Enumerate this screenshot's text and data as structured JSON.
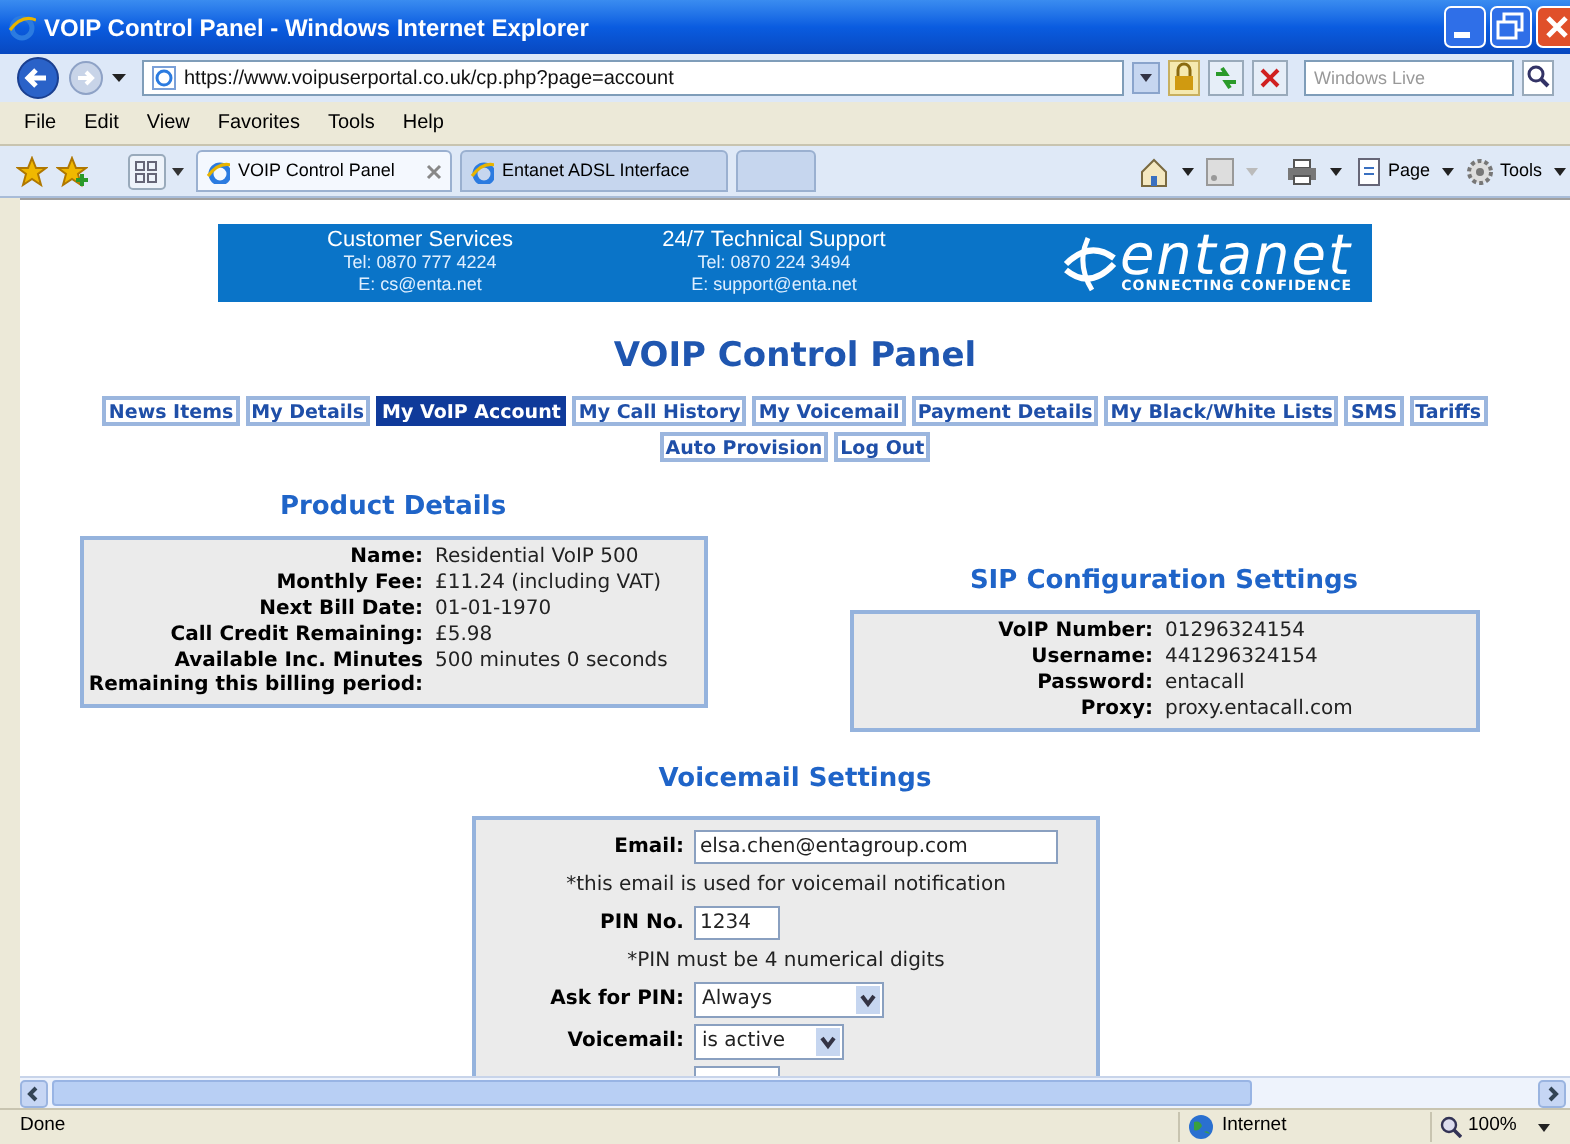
{
  "window": {
    "title": "VOIP Control Panel - Windows Internet Explorer"
  },
  "address_bar": {
    "url": "https://www.voipuserportal.co.uk/cp.php?page=account",
    "search_placeholder": "Windows Live"
  },
  "menu": [
    "File",
    "Edit",
    "View",
    "Favorites",
    "Tools",
    "Help"
  ],
  "tabs": [
    {
      "label": "VOIP Control Panel",
      "selected": true
    },
    {
      "label": "Entanet ADSL Interface",
      "selected": false
    }
  ],
  "command_bar": [
    "Page",
    "Tools"
  ],
  "banner": {
    "customer": {
      "heading": "Customer Services",
      "tel": "Tel: 0870 777 4224",
      "email": "E: cs@enta.net"
    },
    "support": {
      "heading": "24/7 Technical Support",
      "tel": "Tel: 0870 224 3494",
      "email": "E: support@enta.net"
    },
    "logo": "entanet",
    "tagline": "CONNECTING CONFIDENCE"
  },
  "page_title": "VOIP Control Panel",
  "nav": [
    {
      "label": "News Items",
      "selected": false
    },
    {
      "label": "My Details",
      "selected": false
    },
    {
      "label": "My VoIP Account",
      "selected": true
    },
    {
      "label": "My Call History",
      "selected": false
    },
    {
      "label": "My Voicemail",
      "selected": false
    },
    {
      "label": "Payment Details",
      "selected": false
    },
    {
      "label": "My Black/White Lists",
      "selected": false
    },
    {
      "label": "SMS",
      "selected": false
    },
    {
      "label": "Tariffs",
      "selected": false
    },
    {
      "label": "Auto Provision",
      "selected": false
    },
    {
      "label": "Log Out",
      "selected": false
    }
  ],
  "product_details": {
    "heading": "Product Details",
    "rows": [
      {
        "label": "Name:",
        "value": "Residential VoIP 500"
      },
      {
        "label": "Monthly Fee:",
        "value": "£11.24 (including VAT)"
      },
      {
        "label": "Next Bill Date:",
        "value": "01-01-1970"
      },
      {
        "label": "Call Credit Remaining:",
        "value": "£5.98"
      },
      {
        "label": "Available Inc. Minutes Remaining this billing period:",
        "value": "500 minutes 0 seconds"
      }
    ]
  },
  "sip_settings": {
    "heading": "SIP Configuration Settings",
    "rows": [
      {
        "label": "VoIP Number:",
        "value": "01296324154"
      },
      {
        "label": "Username:",
        "value": "441296324154"
      },
      {
        "label": "Password:",
        "value": "entacall"
      },
      {
        "label": "Proxy:",
        "value": "proxy.entacall.com"
      }
    ]
  },
  "voicemail_settings": {
    "heading": "Voicemail Settings",
    "rows": [
      {
        "kind": "text",
        "label": "Email:",
        "value": "elsa.chen@entagroup.com"
      },
      {
        "kind": "note",
        "text": "*this email is used for voicemail notification"
      },
      {
        "kind": "pin",
        "label": "PIN No.",
        "value": "1234"
      },
      {
        "kind": "note",
        "text": "*PIN must be 4 numerical digits"
      },
      {
        "kind": "select",
        "label": "Ask for PIN:",
        "value": "Always"
      },
      {
        "kind": "select_small",
        "label": "Voicemail:",
        "value": "is active"
      },
      {
        "kind": "cut"
      }
    ]
  },
  "status_bar": {
    "status": "Done",
    "zone": "Internet",
    "zoom": "100%"
  }
}
